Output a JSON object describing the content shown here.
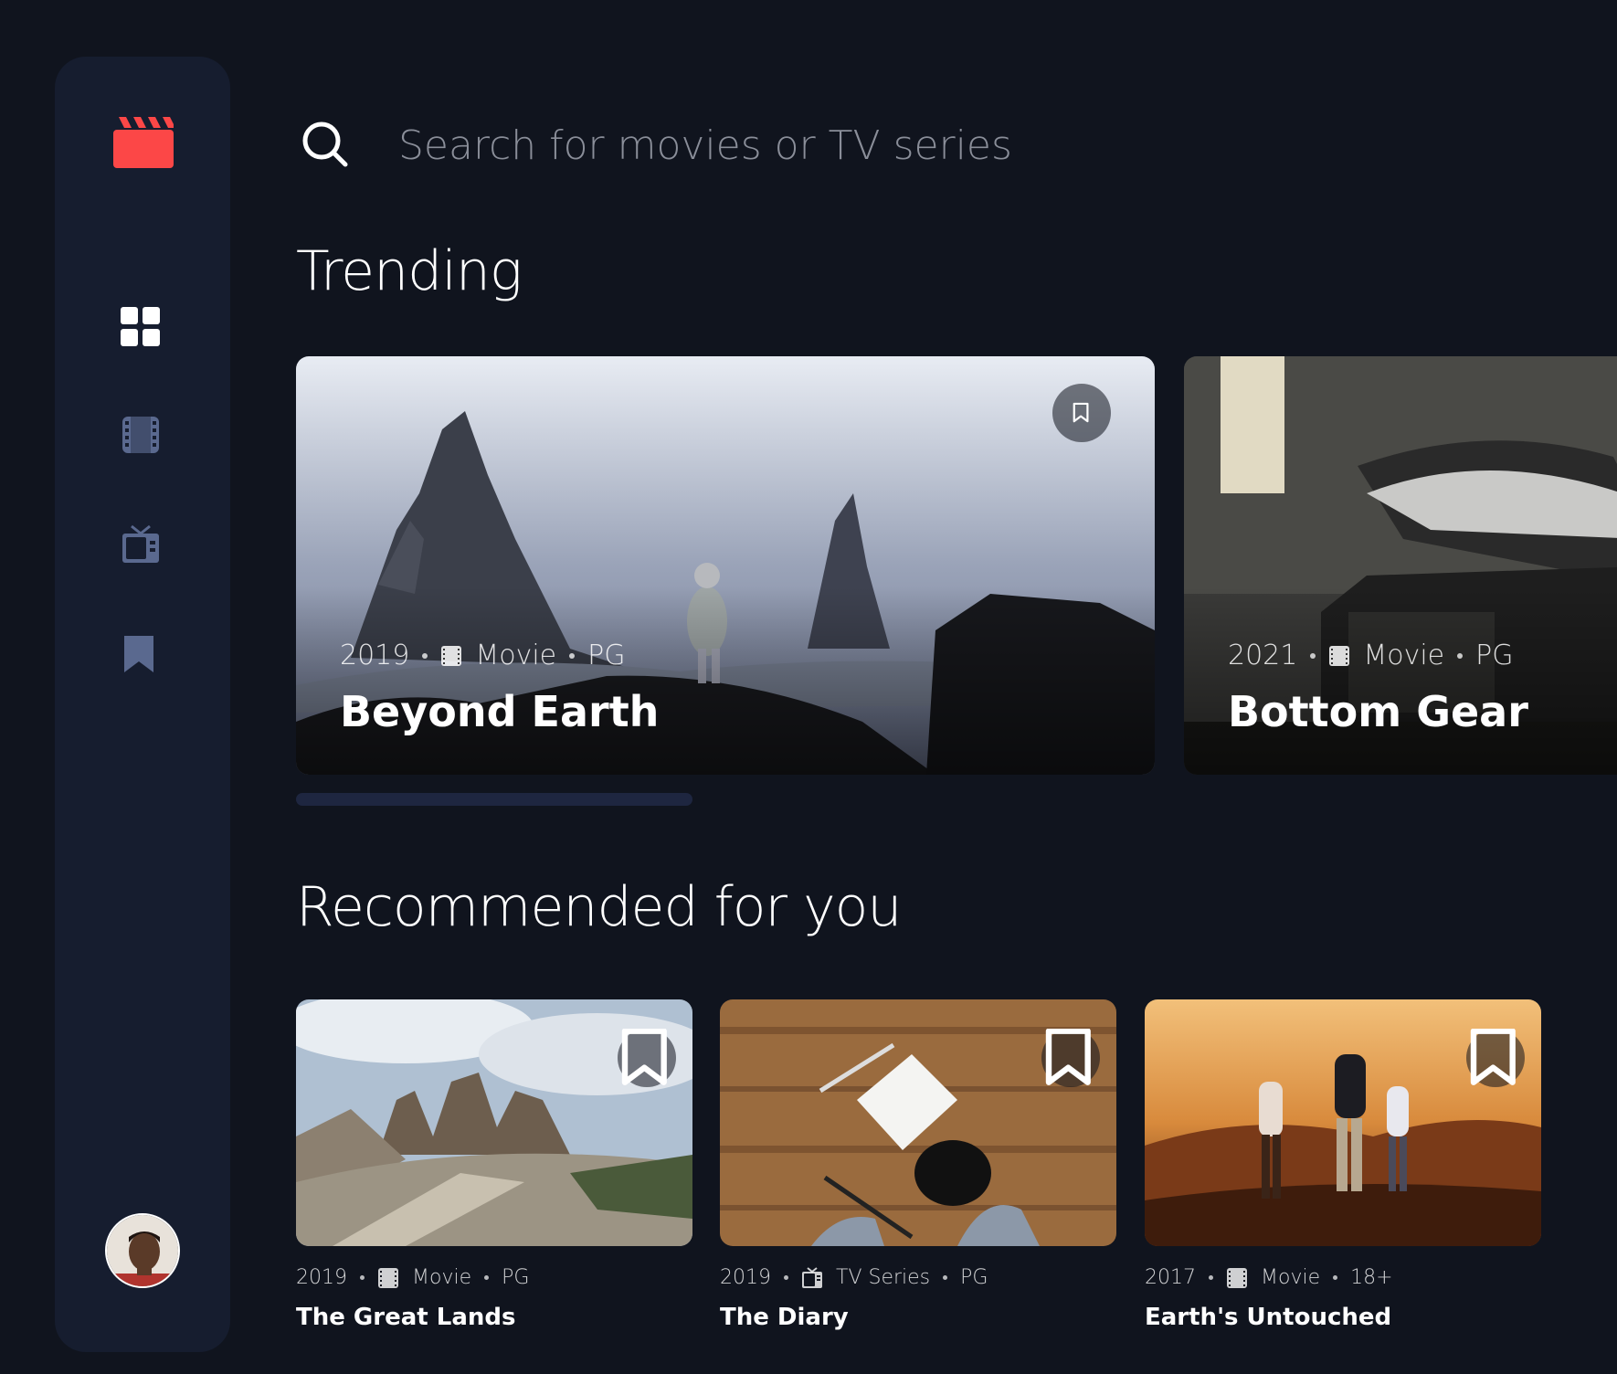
{
  "search": {
    "placeholder": "Search for movies or TV series"
  },
  "sidebar": {
    "items": [
      {
        "name": "home",
        "icon": "grid-icon",
        "active": true
      },
      {
        "name": "movies",
        "icon": "film-icon",
        "active": false
      },
      {
        "name": "tv-series",
        "icon": "tv-icon",
        "active": false
      },
      {
        "name": "bookmarks",
        "icon": "bookmark-icon",
        "active": false
      }
    ]
  },
  "trending": {
    "heading": "Trending",
    "items": [
      {
        "year": "2019",
        "category": "Movie",
        "rating": "PG",
        "title": "Beyond Earth"
      },
      {
        "year": "2021",
        "category": "Movie",
        "rating": "PG",
        "title": "Bottom Gear"
      }
    ]
  },
  "recommended": {
    "heading": "Recommended for you",
    "items": [
      {
        "year": "2019",
        "category": "Movie",
        "rating": "PG",
        "title": "The Great Lands"
      },
      {
        "year": "2019",
        "category": "TV Series",
        "rating": "PG",
        "title": "The Diary"
      },
      {
        "year": "2017",
        "category": "Movie",
        "rating": "18+",
        "title": "Earth's Untouched"
      }
    ]
  },
  "colors": {
    "background": "#10141E",
    "sidebar": "#161D2F",
    "accent": "#FC4747",
    "nav_inactive": "#5A698F",
    "nav_active": "#FFFFFF"
  }
}
